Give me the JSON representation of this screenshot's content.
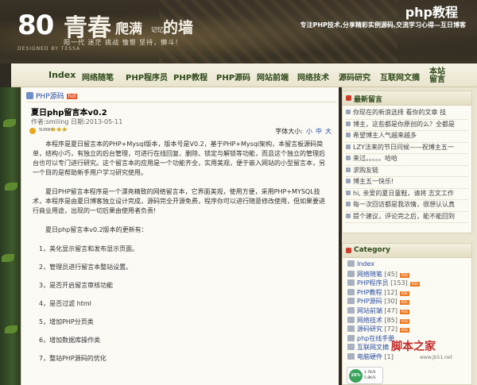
{
  "header": {
    "logo_num": "80",
    "logo_main": "青春",
    "logo_small": "爬满",
    "logo_tiny": "记忆",
    "logo_end": "的墙",
    "slogan": "阳一代 迷茫 挑战 憧憬 坚持，懒斗！",
    "design": "DESIGNED BY TESSA",
    "site_name": "php教程",
    "site_desc": "专注PHP技术,分享精彩实例源码,交流学习心得—互日博客"
  },
  "nav": {
    "items": [
      "Index",
      "网络随笔",
      "PHP程序员",
      "PHP教程",
      "PHP源码",
      "网站前端",
      "网络技术",
      "源码研究",
      "互联网文摘"
    ],
    "last_line1": "本站",
    "last_line2": "留言"
  },
  "crumb": {
    "label": "PHP源码",
    "badge": "hot"
  },
  "post": {
    "title": "夏日php留言本v0.2",
    "meta": "作者:smiling 日期:2013-05-11",
    "rating_label": "SUNNY",
    "stars": "★★★",
    "font_label": "字体大小:",
    "font_small": "小",
    "font_mid": "中",
    "font_large": "大"
  },
  "article": {
    "p1": "本程序是夏日留言本的PHP+Mysql版本，版本号是V0.2，基于PHP+Mysql架构，本留言板源码简单，结构小巧，有独立的后台管理，可进行在线回复、删除、锁定与解锁等功能，而且这个独立的管理后台也可以专门进行研究。这个留言本的应用是一个功能齐全，实用美观，便于嵌入网站的小型留言本，另一个目的是帮助新手用户学习研究使用。",
    "p2": "夏日PHP留言本程序是一个漂亮精致的网络留言本，它界面美观，使用方便，采用PHP+MYSQL技术，本程序是由夏日博客独立设计完成，源码完全开源免费，程序你可以进行随意修改使用，但如果要进行商业用途，出现的一切后果由使用者负责!",
    "p3": "夏日php留言本v0.2版本的更新有：",
    "items": [
      "1，美化显示留言和发布显示页面。",
      "2，管理员进行留言本整站设置。",
      "3，是否开启留言审核功能",
      "4，是否过滤  html",
      "5，增加PHP分页类",
      "6，增加数据库操作类",
      "7，整站PHP源码的优化"
    ]
  },
  "recent": {
    "title": "最新留言",
    "items": [
      "你现在的新浪选择  看你的文章  技",
      "博主，这些都是你原创的么？全都是",
      "希望博主人气越来越多",
      "LZY法来的节日问候——祝博主五一",
      "来过。。。。。哈哈",
      "求购友链",
      "博主五一快乐!",
      "hi, 亲爱的夏日童鞋，请将  志文工作",
      "每一次回访都是我浓情，很想认认真",
      "提个建议，评论完之后，能不能回到"
    ]
  },
  "category": {
    "title": "Category",
    "items": [
      {
        "name": "Index",
        "count": ""
      },
      {
        "name": "网络随笔",
        "count": "[45]"
      },
      {
        "name": "PHP程序员",
        "count": "[153]"
      },
      {
        "name": "PHP教程",
        "count": "[12]"
      },
      {
        "name": "PHP源码",
        "count": "[30]"
      },
      {
        "name": "网站前端",
        "count": "[47]"
      },
      {
        "name": "网络技术",
        "count": "[85]"
      },
      {
        "name": "源码研究",
        "count": "[72]"
      },
      {
        "name": "php在线手册",
        "count": ""
      },
      {
        "name": "互联网文摘",
        "count": ""
      },
      {
        "name": "电脑硬件",
        "count": "[1]"
      }
    ]
  },
  "stats": {
    "percent": "28%",
    "up": "1.7K/S",
    "down": "5.8K/S"
  },
  "watermark": {
    "text": "脚本之家",
    "url": "www.jb51.net"
  }
}
